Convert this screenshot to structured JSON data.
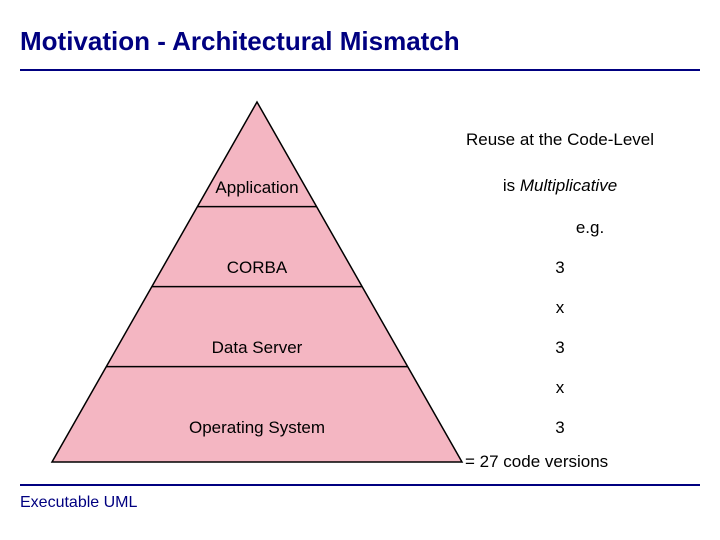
{
  "title": "Motivation - Architectural Mismatch",
  "footer": "Executable UML",
  "pyramid": {
    "layers": [
      "Application",
      "CORBA",
      "Data Server",
      "Operating System"
    ]
  },
  "right": {
    "heading": "Reuse at the Code-Level",
    "sub_prefix": "is ",
    "sub_em": "Multiplicative",
    "eg": "e.g.",
    "n1": "3",
    "x1": "x",
    "n2": "3",
    "x2": "x",
    "n3": "3",
    "result": "= 27 code versions"
  },
  "chart_data": {
    "type": "table",
    "title": "Reuse at the Code-Level is Multiplicative",
    "categories": [
      "Application",
      "CORBA",
      "Data Server",
      "Operating System"
    ],
    "values": [
      null,
      3,
      3,
      3
    ],
    "annotation": "= 27 code versions"
  }
}
